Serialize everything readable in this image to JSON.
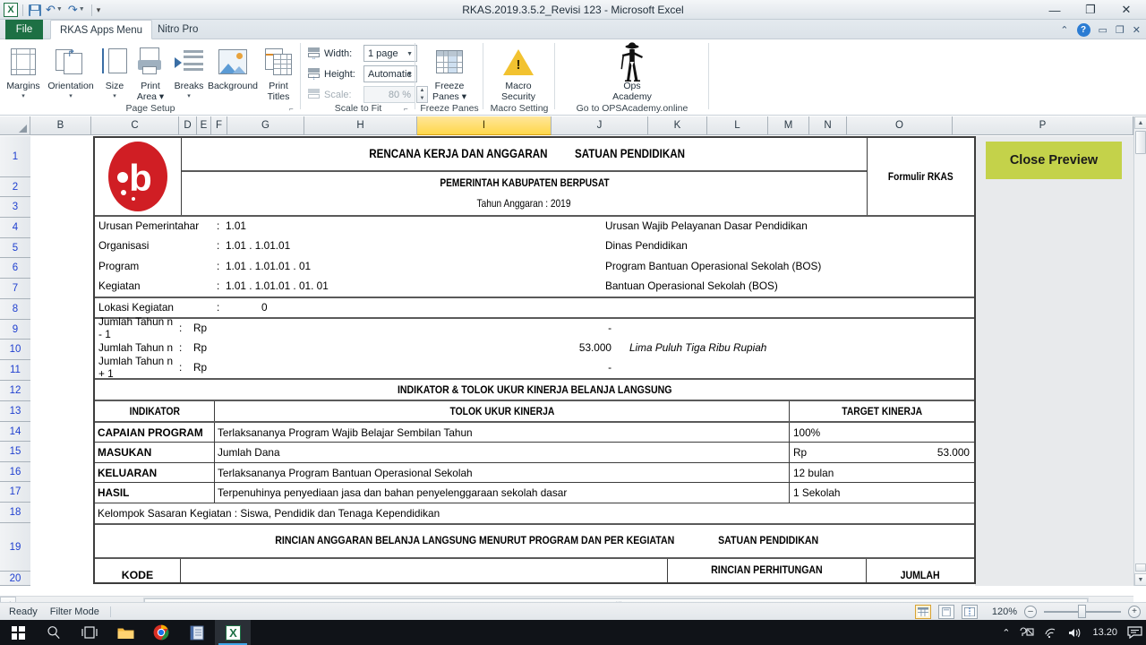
{
  "window": {
    "title": "RKAS.2019.3.5.2_Revisi 123  -  Microsoft Excel",
    "minimize": "—",
    "restore": "❐",
    "close": "✕",
    "app_icon": "excel-icon"
  },
  "quick_access": {
    "save": "save-icon",
    "undo": "↶",
    "redo": "↷",
    "customize": "▾"
  },
  "ribbon_help": {
    "collapse": "⌃",
    "help": "?",
    "minimize_win": "▭",
    "restore_win": "❐",
    "close_win": "✕"
  },
  "tabs": [
    {
      "label": "File",
      "active": false,
      "kind": "file"
    },
    {
      "label": "RKAS Apps Menu",
      "active": true,
      "kind": "normal"
    },
    {
      "label": "Nitro Pro",
      "active": false,
      "kind": "normal"
    }
  ],
  "ribbon": {
    "groups": [
      {
        "name": "Page Setup",
        "label": "Page Setup",
        "buttons": [
          {
            "label": "Margins",
            "caret": "▾",
            "icon": "margins-icon"
          },
          {
            "label": "Orientation",
            "caret": "▾",
            "icon": "orientation-icon"
          },
          {
            "label": "Size",
            "caret": "▾",
            "icon": "size-icon"
          },
          {
            "label": "Print",
            "label2": "Area ▾",
            "icon": "print-area-icon"
          },
          {
            "label": "Breaks",
            "caret": "▾",
            "icon": "breaks-icon"
          },
          {
            "label": "Background",
            "icon": "background-icon"
          },
          {
            "label": "Print",
            "label2": "Titles",
            "icon": "print-titles-icon"
          }
        ]
      },
      {
        "name": "Scale to Fit",
        "label": "Scale to Fit",
        "fields": [
          {
            "label": "Width:",
            "value": "1 page",
            "disabled": false,
            "icon": "width-icon"
          },
          {
            "label": "Height:",
            "value": "Automatic",
            "disabled": false,
            "icon": "height-icon"
          },
          {
            "label": "Scale:",
            "value": "80 %",
            "disabled": true,
            "icon": "scale-icon"
          }
        ]
      },
      {
        "name": "Freeze Panes",
        "label": "Freeze Panes",
        "buttons": [
          {
            "label": "Freeze",
            "label2": "Panes ▾",
            "icon": "freeze-panes-icon"
          }
        ]
      },
      {
        "name": "Macro Setting",
        "label": "Macro Setting",
        "buttons": [
          {
            "label": "Macro",
            "label2": "Security",
            "icon": "macro-security-icon"
          }
        ]
      },
      {
        "name": "Ops Academy",
        "label": "Go to OPSAcademy.online",
        "buttons": [
          {
            "label": "Ops",
            "label2": "Academy",
            "icon": "ops-academy-icon"
          }
        ]
      }
    ]
  },
  "grid": {
    "columns": [
      "B",
      "C",
      "D",
      "E",
      "F",
      "G",
      "H",
      "I",
      "J",
      "K",
      "L",
      "M",
      "N",
      "O",
      "P"
    ],
    "selected_column": "I",
    "rows": [
      "1",
      "2",
      "3",
      "4",
      "5",
      "6",
      "7",
      "8",
      "9",
      "10",
      "11",
      "12",
      "13",
      "14",
      "15",
      "16",
      "17",
      "18",
      "19",
      "20"
    ]
  },
  "close_preview_button": "Close Preview",
  "document": {
    "logo_letter": "b",
    "title_line1": "RENCANA KERJA DAN ANGGARAN",
    "title_line2": "SATUAN PENDIDIKAN",
    "subtitle": "PEMERINTAH KABUPATEN BERPUSAT",
    "year_line": "Tahun Anggaran : 2019",
    "form_label": "Formulir RKAS",
    "info_rows": [
      {
        "key": "Urusan Pemerintahar",
        "colon": ":",
        "value": "1.01",
        "right": "Urusan Wajib Pelayanan Dasar Pendidikan"
      },
      {
        "key": "Organisasi",
        "colon": ":",
        "value": "1.01 . 1.01.01",
        "right": "Dinas Pendidikan"
      },
      {
        "key": "Program",
        "colon": ":",
        "value": "1.01 . 1.01.01 . 01",
        "right": "Program Bantuan Operasional Sekolah (BOS)"
      },
      {
        "key": "Kegiatan",
        "colon": ":",
        "value": "1.01 . 1.01.01 . 01. 01",
        "right": "Bantuan Operasional Sekolah (BOS)"
      }
    ],
    "lokasi": {
      "key": "Lokasi Kegiatan",
      "colon": ":",
      "value": "0"
    },
    "sum_rows": [
      {
        "key": "Jumlah Tahun n - 1",
        "colon": ":",
        "currency": "Rp",
        "amount": "-",
        "terbilang": ""
      },
      {
        "key": "Jumlah Tahun n",
        "colon": ":",
        "currency": "Rp",
        "amount": "53.000",
        "terbilang": "Lima Puluh Tiga Ribu  Rupiah"
      },
      {
        "key": "Jumlah Tahun n + 1",
        "colon": ":",
        "currency": "Rp",
        "amount": "-",
        "terbilang": ""
      }
    ],
    "indicator_band_title": "INDIKATOR & TOLOK UKUR KINERJA  BELANJA LANGSUNG",
    "indicator_headers": [
      "INDIKATOR",
      "TOLOK UKUR KINERJA",
      "TARGET KINERJA"
    ],
    "indicator_rows": [
      {
        "indikator": "CAPAIAN PROGRAM",
        "tolok": "Terlaksananya Program Wajib Belajar Sembilan Tahun",
        "target_prefix": "",
        "target": "100%"
      },
      {
        "indikator": "MASUKAN",
        "tolok": "Jumlah Dana",
        "target_prefix": "Rp",
        "target": "53.000"
      },
      {
        "indikator": "KELUARAN",
        "tolok": "Terlaksananya Program Bantuan Operasional Sekolah",
        "target_prefix": "",
        "target": "12 bulan"
      },
      {
        "indikator": "HASIL",
        "tolok": "Terpenuhinya penyediaan jasa dan bahan penyelenggaraan sekolah dasar",
        "target_prefix": "",
        "target": "1 Sekolah"
      }
    ],
    "kelompok_sasaran": "Kelompok Sasaran Kegiatan : Siswa, Pendidik dan Tenaga Kependidikan",
    "rincian_line1": "RINCIAN ANGGARAN BELANJA LANGSUNG MENURUT PROGRAM DAN PER KEGIATAN",
    "rincian_line2": "SATUAN PENDIDIKAN",
    "detail_headers": {
      "kode": "KODE",
      "uraian": "",
      "rincian": "RINCIAN PERHITUNGAN",
      "jumlah": "JUMLAH"
    }
  },
  "status_bar": {
    "mode": "Ready",
    "filter": "Filter Mode",
    "view_normal": "normal-view-icon",
    "view_layout": "page-layout-view-icon",
    "view_break": "page-break-view-icon",
    "zoom": "120%",
    "zoom_out": "–",
    "zoom_in": "+"
  },
  "taskbar": {
    "items": [
      {
        "icon": "windows-start-icon",
        "name": "start-button",
        "active": false
      },
      {
        "icon": "search-icon",
        "name": "taskbar-search",
        "active": false
      },
      {
        "icon": "task-view-icon",
        "name": "task-view",
        "active": false
      },
      {
        "icon": "file-explorer-icon",
        "name": "taskbar-file-explorer",
        "active": false
      },
      {
        "icon": "chrome-icon",
        "name": "taskbar-chrome",
        "active": false
      },
      {
        "icon": "notepad-icon",
        "name": "taskbar-notepad",
        "active": false
      },
      {
        "icon": "excel-icon",
        "name": "taskbar-excel",
        "active": true
      }
    ],
    "tray": {
      "chevron": "⌃",
      "keyboard": "keyboard-icon",
      "network": "network-icon",
      "volume": "volume-icon",
      "clock": "13.20",
      "notifications": "notification-icon"
    }
  }
}
